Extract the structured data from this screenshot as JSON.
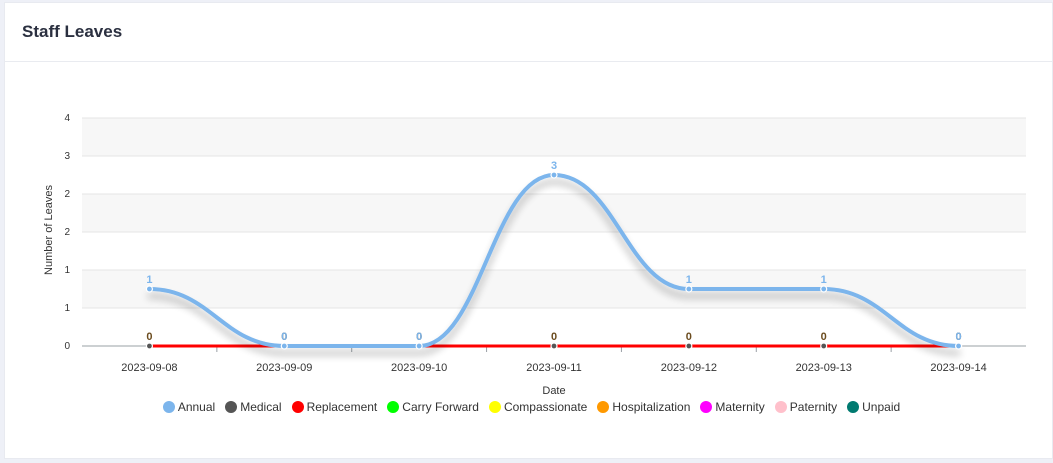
{
  "card": {
    "title": "Staff Leaves"
  },
  "chart_data": {
    "type": "line",
    "smooth": true,
    "title": "",
    "xlabel": "Date",
    "ylabel": "Number of Leaves",
    "x": [
      "2023-09-08",
      "2023-09-09",
      "2023-09-10",
      "2023-09-11",
      "2023-09-12",
      "2023-09-13",
      "2023-09-14"
    ],
    "ylim": [
      0,
      4
    ],
    "yticks": [
      0,
      1,
      1,
      2,
      2,
      3,
      4
    ],
    "grid": true,
    "legend_position": "bottom",
    "series": [
      {
        "name": "Annual",
        "color": "#7cb5ec",
        "values": [
          1,
          0,
          0,
          3,
          1,
          1,
          0
        ],
        "labels_shown": true
      },
      {
        "name": "Medical",
        "color": "#5c4a42",
        "values": [
          0,
          0,
          0,
          0,
          0,
          0,
          0
        ],
        "labels_shown": true
      },
      {
        "name": "Replacement",
        "color": "#ff0000",
        "values": [
          0,
          0,
          0,
          0,
          0,
          0,
          0
        ],
        "labels_shown": false
      },
      {
        "name": "Carry Forward",
        "color": "#00ff00",
        "values": [
          0,
          0,
          0,
          0,
          0,
          0,
          0
        ],
        "labels_shown": false
      },
      {
        "name": "Compassionate",
        "color": "#ffff00",
        "values": [
          0,
          0,
          0,
          0,
          0,
          0,
          0
        ],
        "labels_shown": false
      },
      {
        "name": "Hospitalization",
        "color": "#ff9900",
        "values": [
          0,
          0,
          0,
          0,
          0,
          0,
          0
        ],
        "labels_shown": false
      },
      {
        "name": "Maternity",
        "color": "#ff00ff",
        "values": [
          0,
          0,
          0,
          0,
          0,
          0,
          0
        ],
        "labels_shown": false
      },
      {
        "name": "Paternity",
        "color": "#ffc0cb",
        "values": [
          0,
          0,
          0,
          0,
          0,
          0,
          0
        ],
        "labels_shown": false
      },
      {
        "name": "Unpaid",
        "color": "#007a70",
        "values": [
          0,
          0,
          0,
          0,
          0,
          0,
          0
        ],
        "labels_shown": false
      }
    ],
    "legend": [
      {
        "name": "Annual",
        "color": "#7cb5ec"
      },
      {
        "name": "Medical",
        "color": "#555555"
      },
      {
        "name": "Replacement",
        "color": "#ff0000"
      },
      {
        "name": "Carry Forward",
        "color": "#00ff00"
      },
      {
        "name": "Compassionate",
        "color": "#ffff00"
      },
      {
        "name": "Hospitalization",
        "color": "#ff9900"
      },
      {
        "name": "Maternity",
        "color": "#ff00ff"
      },
      {
        "name": "Paternity",
        "color": "#ffc0cb"
      },
      {
        "name": "Unpaid",
        "color": "#007a70"
      }
    ]
  }
}
